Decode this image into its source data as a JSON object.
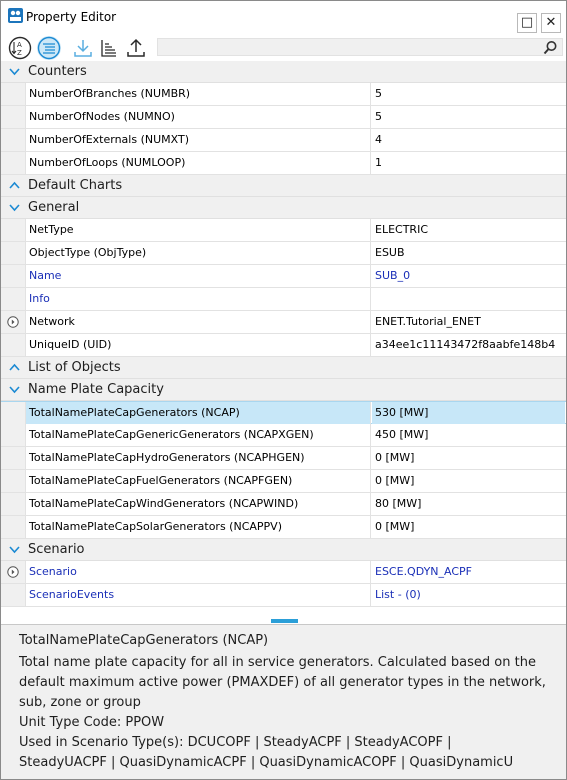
{
  "window": {
    "title": "Property Editor",
    "minimize_glyph": "□",
    "close_glyph": "✕"
  },
  "toolbar": {
    "sort_alpha_icon": "sort-alphabetical-icon",
    "categorized_icon": "categorized-icon",
    "import_icon": "download-icon",
    "hierarchy_icon": "hierarchy-sort-icon",
    "export_icon": "upload-icon",
    "search_placeholder": ""
  },
  "categories": [
    {
      "label": "Counters",
      "expanded": true
    },
    {
      "label": "Default Charts",
      "expanded": false
    },
    {
      "label": "General",
      "expanded": true
    },
    {
      "label": "List of Objects",
      "expanded": false
    },
    {
      "label": "Name Plate Capacity",
      "expanded": true
    },
    {
      "label": "Scenario",
      "expanded": true
    }
  ],
  "counters": [
    {
      "name": "NumberOfBranches (NUMBR)",
      "value": "5"
    },
    {
      "name": "NumberOfNodes (NUMNO)",
      "value": "5"
    },
    {
      "name": "NumberOfExternals (NUMXT)",
      "value": "4"
    },
    {
      "name": "NumberOfLoops (NUMLOOP)",
      "value": "1"
    }
  ],
  "general": [
    {
      "name": "NetType",
      "value": "ELECTRIC"
    },
    {
      "name": "ObjectType (ObjType)",
      "value": "ESUB"
    },
    {
      "name": "Name",
      "value": "SUB_0"
    },
    {
      "name": "Info",
      "value": ""
    },
    {
      "name": "Network",
      "value": "ENET.Tutorial_ENET"
    },
    {
      "name": "UniqueID (UID)",
      "value": "a34ee1c11143472f8aabfe148b4"
    }
  ],
  "nameplate": [
    {
      "name": "TotalNamePlateCapGenerators (NCAP)",
      "value": "530 [MW]"
    },
    {
      "name": "TotalNamePlateCapGenericGenerators (NCAPXGEN)",
      "value": "450 [MW]"
    },
    {
      "name": "TotalNamePlateCapHydroGenerators (NCAPHGEN)",
      "value": "0 [MW]"
    },
    {
      "name": "TotalNamePlateCapFuelGenerators (NCAPFGEN)",
      "value": "0 [MW]"
    },
    {
      "name": "TotalNamePlateCapWindGenerators (NCAPWIND)",
      "value": "80 [MW]"
    },
    {
      "name": "TotalNamePlateCapSolarGenerators (NCAPPV)",
      "value": "0 [MW]"
    }
  ],
  "scenario": [
    {
      "name": "Scenario",
      "value": "ESCE.QDYN_ACPF"
    },
    {
      "name": "ScenarioEvents",
      "value": "List - (0)"
    }
  ],
  "description": {
    "title": "TotalNamePlateCapGenerators (NCAP)",
    "text": "Total name plate capacity for all in service generators. Calculated based on the default maximum active power (PMAXDEF) of all generator types in the network, sub, zone or group",
    "unit": "Unit Type Code: PPOW",
    "scenario_line1": "Used in Scenario Type(s): DCUCOPF | SteadyACPF | SteadyACOPF |",
    "scenario_line2": "SteadyUACPF  |  QuasiDynamicACPF  |  QuasiDynamicACOPF  | QuasiDynamicU"
  },
  "colors": {
    "accent": "#2b9fd8",
    "selected_row": "#c7e7f8",
    "link": "#1a2fb7",
    "category_bg": "#f0f0f0"
  }
}
